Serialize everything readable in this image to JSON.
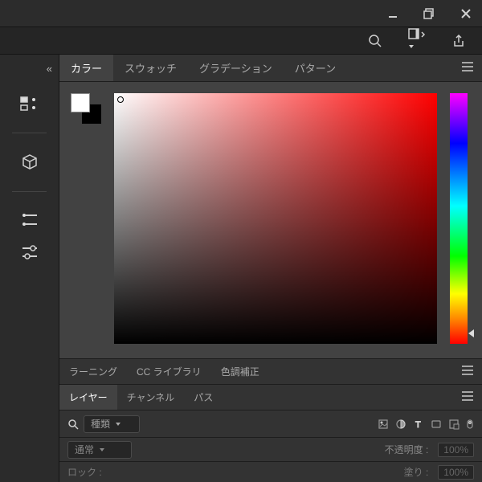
{
  "titlebar": {
    "minimize": "minimize",
    "maximize": "maximize-restore",
    "close": "close"
  },
  "topicons": {
    "search": "search",
    "panel_select": "panel-select",
    "share": "share"
  },
  "toolbar": {
    "collapse": "«"
  },
  "color_panel": {
    "tabs": {
      "color": "カラー",
      "swatches": "スウォッチ",
      "gradient": "グラデーション",
      "pattern": "パターン"
    },
    "fg_color": "#ffffff",
    "bg_color": "#000000",
    "hue_deg": 0
  },
  "mid_tabs": {
    "learning": "ラーニング",
    "cc_libraries": "CC ライブラリ",
    "adjustments": "色調補正"
  },
  "layers": {
    "tabs": {
      "layers": "レイヤー",
      "channels": "チャンネル",
      "paths": "パス"
    },
    "filter_label": "種類",
    "blend_mode": "通常",
    "opacity_label": "不透明度 :",
    "opacity_value": "100%",
    "lock_label": "ロック :",
    "fill_label": "塗り :",
    "fill_value": "100%"
  }
}
